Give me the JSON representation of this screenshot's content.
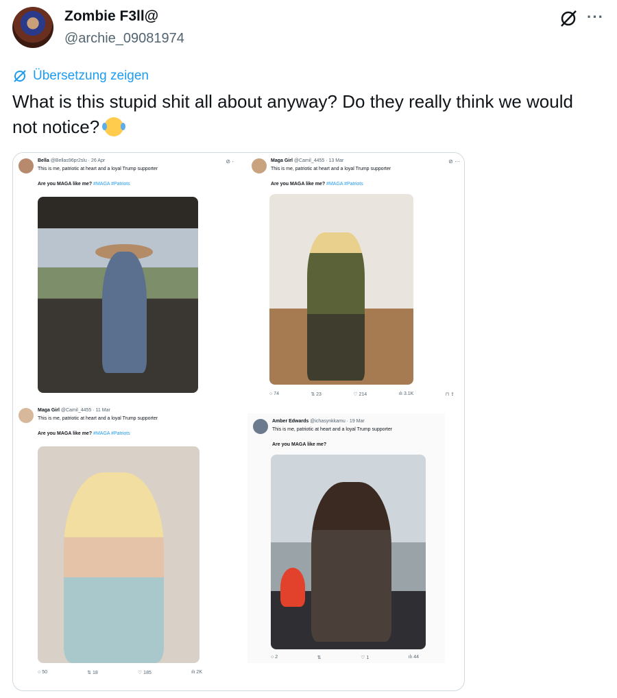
{
  "author": {
    "name": "Zombie F3ll@",
    "handle": "@archie_09081974"
  },
  "translate_label": "Übersetzung zeigen",
  "tweet_text": "What is this stupid shit all about anyway? Do they really think we would not notice?",
  "icons": {
    "grok": "grok-icon",
    "more": "more-icon",
    "translate": "translate-icon"
  },
  "colors": {
    "link": "#1d9bf0",
    "secondary": "#536471",
    "text": "#0f1419",
    "border": "#cfd9de"
  },
  "screenshot_posts": [
    {
      "name": "Bella",
      "meta": "@Bellas96pr2slu · 26 Apr",
      "text": "This is me, patriotic at heart and a loyal Trump supporter",
      "question": "Are you MAGA like me?",
      "hashtags": "#MAGA #Patriots",
      "stats": {
        "replies": "",
        "reposts": "",
        "likes": "",
        "views": ""
      }
    },
    {
      "name": "Maga Girl",
      "meta": "@Camil_4455 · 13 Mar",
      "text": "This is me, patriotic at heart and a loyal Trump supporter",
      "question": "Are you MAGA like me?",
      "hashtags": "#MAGA #Patriots",
      "stats": {
        "replies": "74",
        "reposts": "23",
        "likes": "214",
        "views": "3.1K"
      }
    },
    {
      "name": "Maga Girl",
      "meta": "@Camil_4455 · 11 Mar",
      "text": "This is me, patriotic at heart and a loyal Trump supporter",
      "question": "Are you MAGA like me?",
      "hashtags": "#MAGA #Patriots",
      "stats": {
        "replies": "50",
        "reposts": "18",
        "likes": "185",
        "views": "2K"
      }
    },
    {
      "name": "Amber Edwards",
      "meta": "@ichasynkkamu · 19 Mar",
      "text": "This is me, patriotic at heart and a loyal Trump supporter",
      "question": "Are you MAGA like me?",
      "hashtags": "",
      "stats": {
        "replies": "2",
        "reposts": "",
        "likes": "1",
        "views": "44"
      }
    }
  ]
}
